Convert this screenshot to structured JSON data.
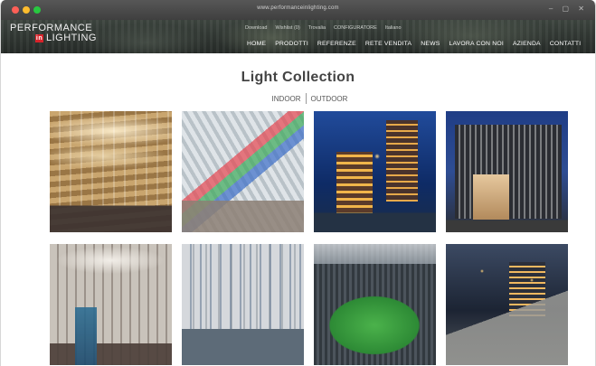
{
  "browser": {
    "url": "www.performanceinlighting.com"
  },
  "header": {
    "logo": {
      "line1": "PERFORMANCE",
      "mark": "in",
      "line2": "LIGHTING"
    },
    "utility_nav": [
      "Download",
      "Wishlist (0)",
      "Trovalia",
      "CONFIGURATORE",
      "Italiano"
    ],
    "main_nav": [
      "HOME",
      "PRODOTTI",
      "REFERENZE",
      "RETE VENDITA",
      "NEWS",
      "LAVORA CON NOI",
      "AZIENDA",
      "CONTATTI"
    ]
  },
  "main": {
    "title": "Light Collection",
    "filters": [
      "INDOOR",
      "OUTDOOR"
    ]
  },
  "colors": {
    "brand_red": "#d8232a",
    "title_text": "#444444"
  }
}
